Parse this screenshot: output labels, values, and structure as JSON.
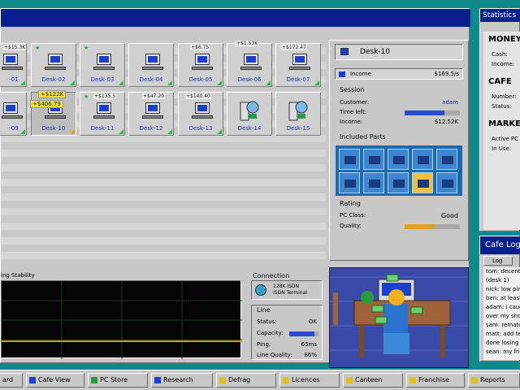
{
  "desks": [
    {
      "label": "-01",
      "money": "+$15.3K",
      "pc": true
    },
    {
      "label": "Desk-02",
      "money": "",
      "pc": true,
      "star": true
    },
    {
      "label": "Desk-03",
      "money": "",
      "pc": true,
      "star": true
    },
    {
      "label": "Desk-04",
      "money": "",
      "pc": true
    },
    {
      "label": "Desk-05",
      "money": "+$6.75",
      "pc": true
    },
    {
      "label": "Desk-06",
      "money": "+$1.53K",
      "pc": true
    },
    {
      "label": "Desk-07",
      "money": "+$172.47",
      "pc": true
    },
    {
      "label": "-09",
      "money": "",
      "pc": true
    },
    {
      "label": "Desk-10",
      "money": "",
      "pc": true
    },
    {
      "label": "Desk-11",
      "money": "+$135.5",
      "pc": true
    },
    {
      "label": "Desk-12",
      "money": "+$47.20",
      "pc": true
    },
    {
      "label": "Desk-13",
      "money": "+$140.40",
      "pc": true
    },
    {
      "label": "Desk-14",
      "money": "",
      "pc": false
    },
    {
      "label": "Desk-15",
      "money": "",
      "pc": false
    }
  ],
  "floating": {
    "a": "+$122K",
    "b": "+$406.79"
  },
  "detail": {
    "title": "Desk-10",
    "income_label": "Income",
    "income_value": "$169.5/s",
    "session_title": "Session",
    "customer_label": "Customer:",
    "customer_value": "adam",
    "time_label": "Time left:",
    "time_fraction": 0.72,
    "income2_label": "Income:",
    "income2_value": "$12.52K",
    "parts_title": "Included Parts",
    "rating_title": "Rating",
    "pcclass_label": "PC Class:",
    "pcclass_value": "Good",
    "quality_label": "Quality:",
    "quality_fraction": 0.55
  },
  "stability": {
    "title": "ing Stability"
  },
  "connection": {
    "title": "Connection",
    "type_line1": "128K ISDN",
    "type_line2": "ISDN Terminal",
    "line_title": "Line",
    "status_label": "Status:",
    "status_value": "OK",
    "capacity_label": "Capacity:",
    "capacity_fraction": 0.85,
    "ping_label": "Ping:",
    "ping_value": "65ms",
    "quality_label": "Line Quality:",
    "quality_value": "86%"
  },
  "stats": {
    "title": "Statistics",
    "money_h": "MONEY",
    "cash": "Cash:",
    "income": "Income:",
    "cafe_h": "CAFE",
    "number": "Number:",
    "status": "Status:",
    "market_h": "MARKET",
    "active": "Active PC",
    "inuse": "In Use:"
  },
  "log": {
    "title": "Cafe Log",
    "tab": "Log",
    "lines": [
      "tom: decent",
      "(desk 1)",
      "nick: low pin",
      "ben: at least",
      "adam: i caug",
      "over my shou",
      "sam: rematch",
      "matt: add te",
      "done losing (",
      "sean: my fri"
    ]
  },
  "taskbar": [
    {
      "label": "ard"
    },
    {
      "label": "Cafe View"
    },
    {
      "label": "PC Store"
    },
    {
      "label": "Research"
    },
    {
      "label": "Defrag"
    },
    {
      "label": "Licences"
    },
    {
      "label": "Canteen"
    },
    {
      "label": "Franchise"
    },
    {
      "label": "Reports"
    }
  ],
  "colors": {
    "accent": "#0a1f8f",
    "desk_label": "#1a2fb0",
    "graph_line": "#c9a020"
  }
}
